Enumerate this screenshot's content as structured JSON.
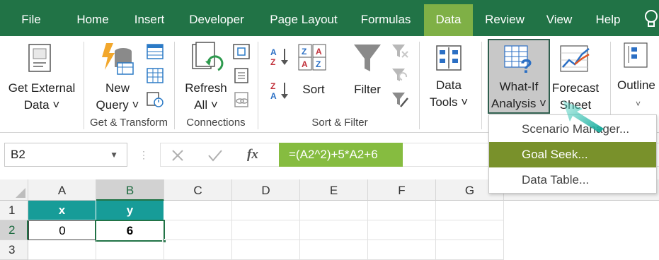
{
  "tabs": [
    {
      "label": "File"
    },
    {
      "label": "Home"
    },
    {
      "label": "Insert"
    },
    {
      "label": "Developer"
    },
    {
      "label": "Page Layout"
    },
    {
      "label": "Formulas"
    },
    {
      "label": "Data"
    },
    {
      "label": "Review"
    },
    {
      "label": "View"
    },
    {
      "label": "Help"
    }
  ],
  "active_tab": "Data",
  "ribbon": {
    "get_external": {
      "line1": "Get External",
      "line2": "Data ˅"
    },
    "new_query": {
      "line1": "New",
      "line2": "Query ˅"
    },
    "get_transform_label": "Get & Transform",
    "refresh": {
      "line1": "Refresh",
      "line2": "All ˅"
    },
    "connections_label": "Connections",
    "sort": "Sort",
    "filter": "Filter",
    "sort_filter_label": "Sort & Filter",
    "az": "A Z",
    "za": "Z A",
    "data_tools": {
      "line1": "Data",
      "line2": "Tools ˅"
    },
    "what_if": {
      "line1": "What-If",
      "line2": "Analysis ˅"
    },
    "forecast": {
      "line1": "Forecast",
      "line2": "Sheet"
    },
    "outline": "Outline"
  },
  "formula_bar": {
    "name_box": "B2",
    "fx": "fx",
    "formula": "=(A2^2)+5*A2+6"
  },
  "grid": {
    "columns": [
      "A",
      "B",
      "C",
      "D",
      "E",
      "F",
      "G"
    ],
    "rows": [
      "1",
      "2",
      "3"
    ],
    "selected_cell": "B2",
    "cells": {
      "A1": "x",
      "B1": "y",
      "A2": "0",
      "B2": "6"
    }
  },
  "menu": {
    "items": [
      {
        "label": "Scenario Manager..."
      },
      {
        "label": "Goal Seek..."
      },
      {
        "label": "Data Table..."
      }
    ],
    "highlighted": "Goal Seek..."
  },
  "colors": {
    "ribbon_green": "#217346",
    "active_tab": "#7fb046",
    "header_cells": "#179c98",
    "highlight_item": "#79912b",
    "formula_highlight": "#86bc40",
    "pointer": "#14a89a"
  }
}
